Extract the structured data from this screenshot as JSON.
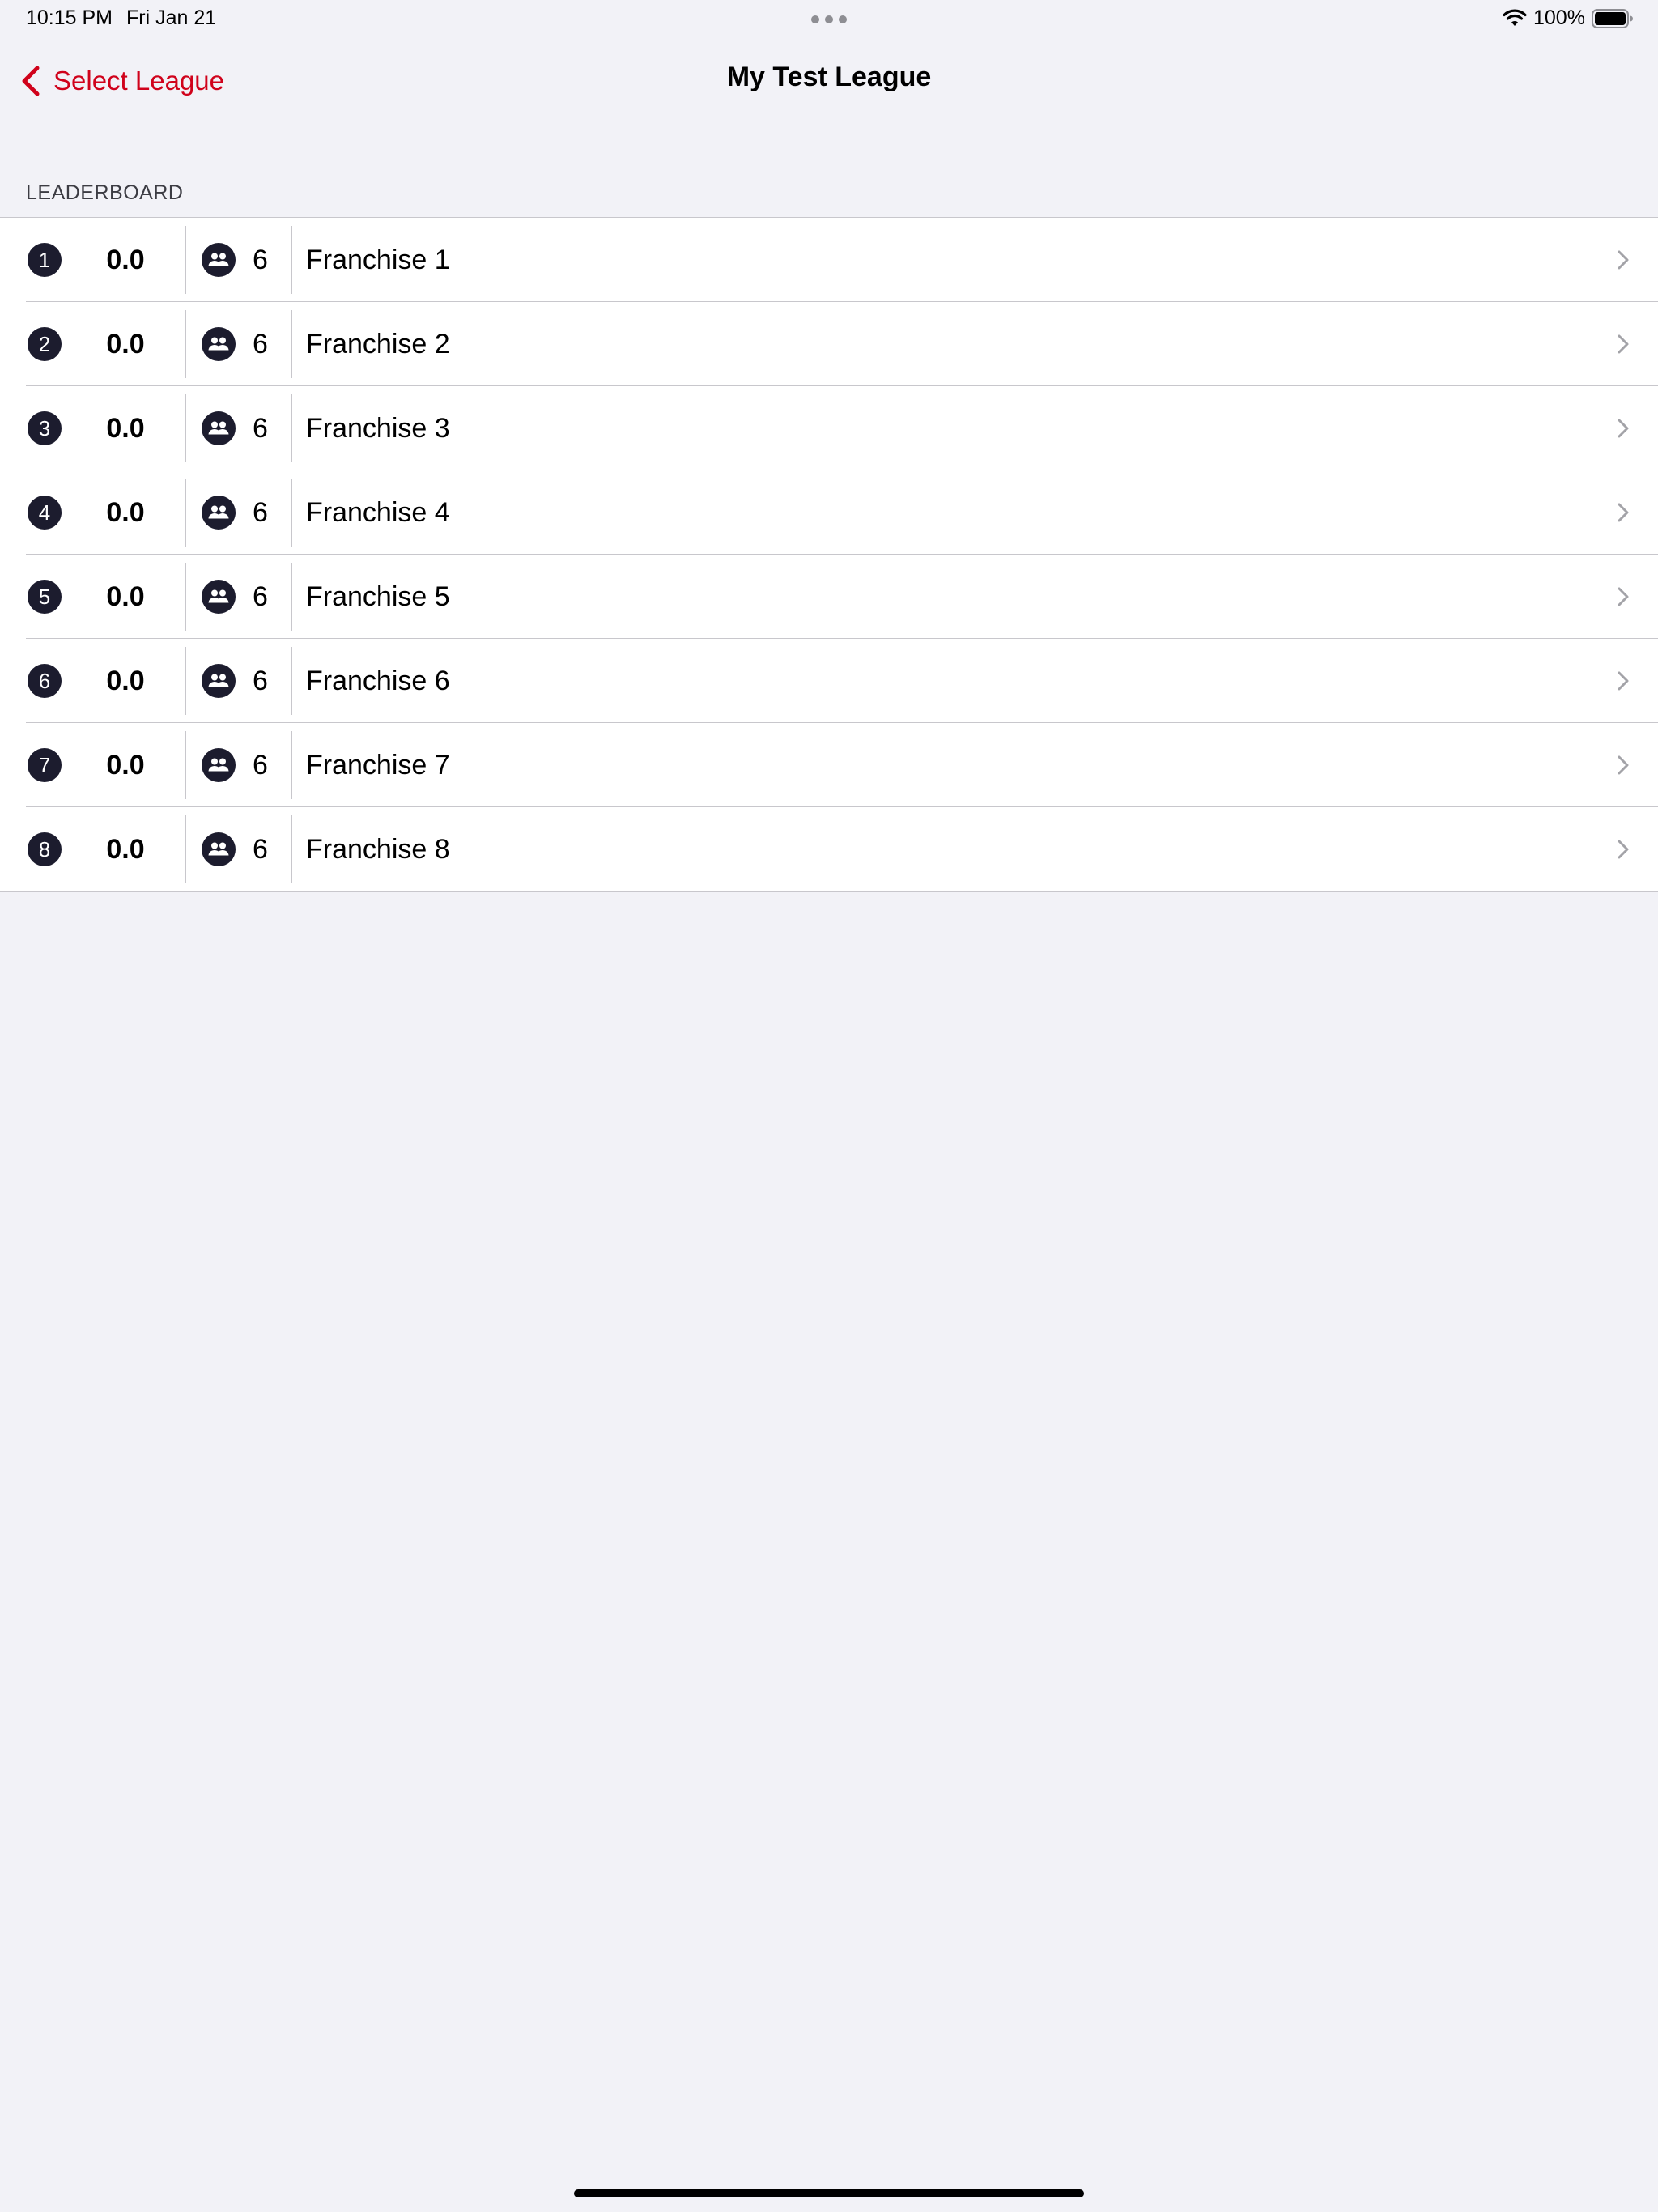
{
  "status_bar": {
    "time": "10:15 PM",
    "date": "Fri Jan 21",
    "battery": "100%"
  },
  "nav": {
    "back_label": "Select League",
    "title": "My Test League"
  },
  "leaderboard": {
    "section_title": "LEADERBOARD",
    "rows": [
      {
        "rank": "1",
        "score": "0.0",
        "members": "6",
        "name": "Franchise 1"
      },
      {
        "rank": "2",
        "score": "0.0",
        "members": "6",
        "name": "Franchise 2"
      },
      {
        "rank": "3",
        "score": "0.0",
        "members": "6",
        "name": "Franchise 3"
      },
      {
        "rank": "4",
        "score": "0.0",
        "members": "6",
        "name": "Franchise 4"
      },
      {
        "rank": "5",
        "score": "0.0",
        "members": "6",
        "name": "Franchise 5"
      },
      {
        "rank": "6",
        "score": "0.0",
        "members": "6",
        "name": "Franchise 6"
      },
      {
        "rank": "7",
        "score": "0.0",
        "members": "6",
        "name": "Franchise 7"
      },
      {
        "rank": "8",
        "score": "0.0",
        "members": "6",
        "name": "Franchise 8"
      }
    ]
  },
  "colors": {
    "accent": "#d0021b",
    "background": "#f2f2f7",
    "badge": "#1c1c2e"
  },
  "icons": {
    "back": "chevron-left-icon",
    "members": "people-icon",
    "disclosure": "chevron-right-icon"
  }
}
